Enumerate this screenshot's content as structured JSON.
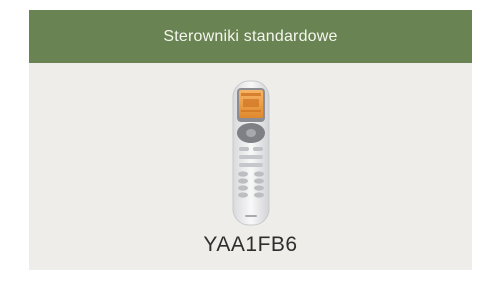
{
  "card": {
    "header_title": "Sterowniki standardowe",
    "product_image_icon": "remote-controller-icon",
    "model_name": "YAA1FB6"
  },
  "colors": {
    "header_bg": "#6a8352",
    "card_bg": "#eeede9"
  }
}
